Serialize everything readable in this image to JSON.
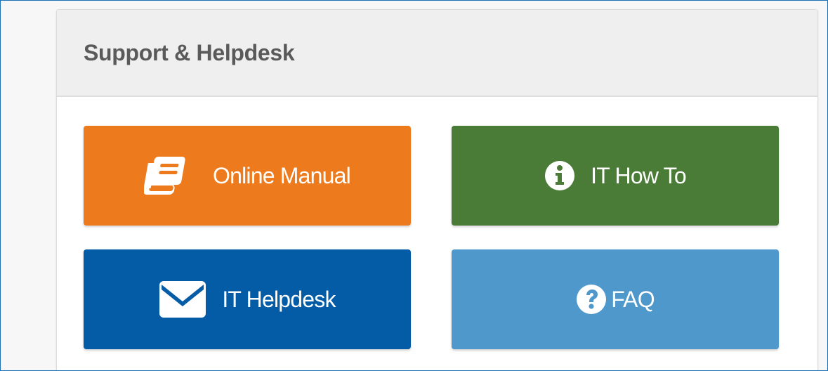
{
  "panel": {
    "title": "Support & Helpdesk"
  },
  "tiles": [
    {
      "label": "Online Manual",
      "icon": "book-icon",
      "color": "#ed7a1c"
    },
    {
      "label": "IT How To",
      "icon": "info-icon",
      "color": "#4a7b37"
    },
    {
      "label": "IT Helpdesk",
      "icon": "envelope-icon",
      "color": "#045ba6"
    },
    {
      "label": "FAQ",
      "icon": "question-icon",
      "color": "#4f98cb"
    }
  ]
}
